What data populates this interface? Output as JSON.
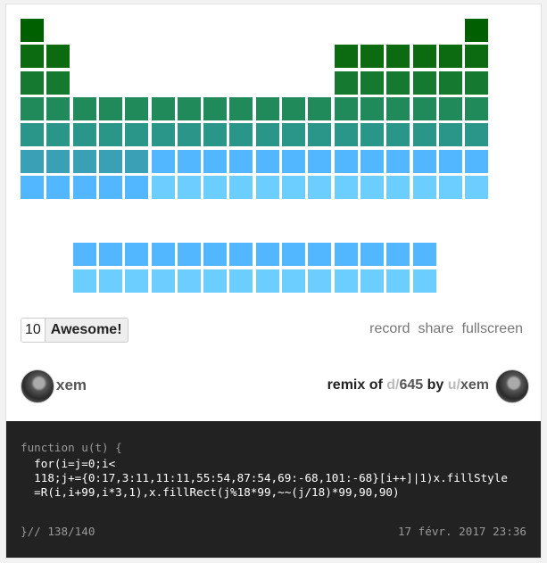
{
  "controls": {
    "likes_count": "10",
    "awesome_label": "Awesome!",
    "record_label": "record",
    "share_label": "share",
    "fullscreen_label": "fullscreen"
  },
  "author": {
    "name": "xem"
  },
  "remix": {
    "prefix": "remix of ",
    "d_prefix": "d/",
    "dweet_number": "645",
    "by": " by ",
    "u_prefix": "u/",
    "user": "xem"
  },
  "code": {
    "line1": "function u(t) {",
    "line2": "  for(i=j=0;i<",
    "line3": "  118;j+={0:17,3:11,11:11,55:54,87:54,69:-68,101:-68}[i++]|1)x.fillStyle",
    "line4": "  =R(i,i+99,i*3,1),x.fillRect(j%18*99,~~(j/18)*99,90,90)",
    "footer_left": "}// 138/140",
    "footer_right": "17 févr. 2017 23:36"
  },
  "colors": {
    "row_colors": [
      "#006000",
      "#0c6a10",
      "#157a2f",
      "#218a5a",
      "#2a968a",
      "#3aa0b6",
      "#52b7ff",
      "#6ccdff"
    ],
    "grid_start_green": "#006000",
    "grid_end_blue": "#6ccdff",
    "code_background": "#222222"
  },
  "canvas": {
    "element_count": 118,
    "columns": 18
  }
}
